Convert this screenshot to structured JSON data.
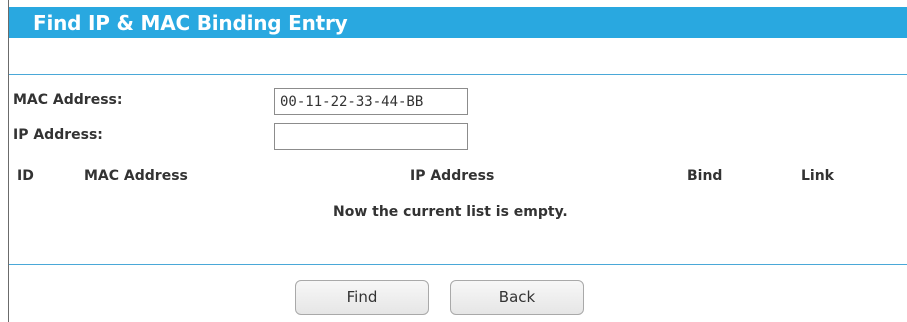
{
  "title": "Find IP & MAC Binding Entry",
  "form": {
    "mac_label": "MAC Address:",
    "mac_value": "00-11-22-33-44-BB",
    "ip_label": "IP Address:",
    "ip_value": ""
  },
  "table": {
    "headers": [
      "ID",
      "MAC Address",
      "IP Address",
      "Bind",
      "Link"
    ],
    "empty_message": "Now the current list is empty."
  },
  "buttons": {
    "find_label": "Find",
    "back_label": "Back"
  },
  "colors": {
    "title_bar": "#29a8e0",
    "divider": "#4aa8d8"
  }
}
